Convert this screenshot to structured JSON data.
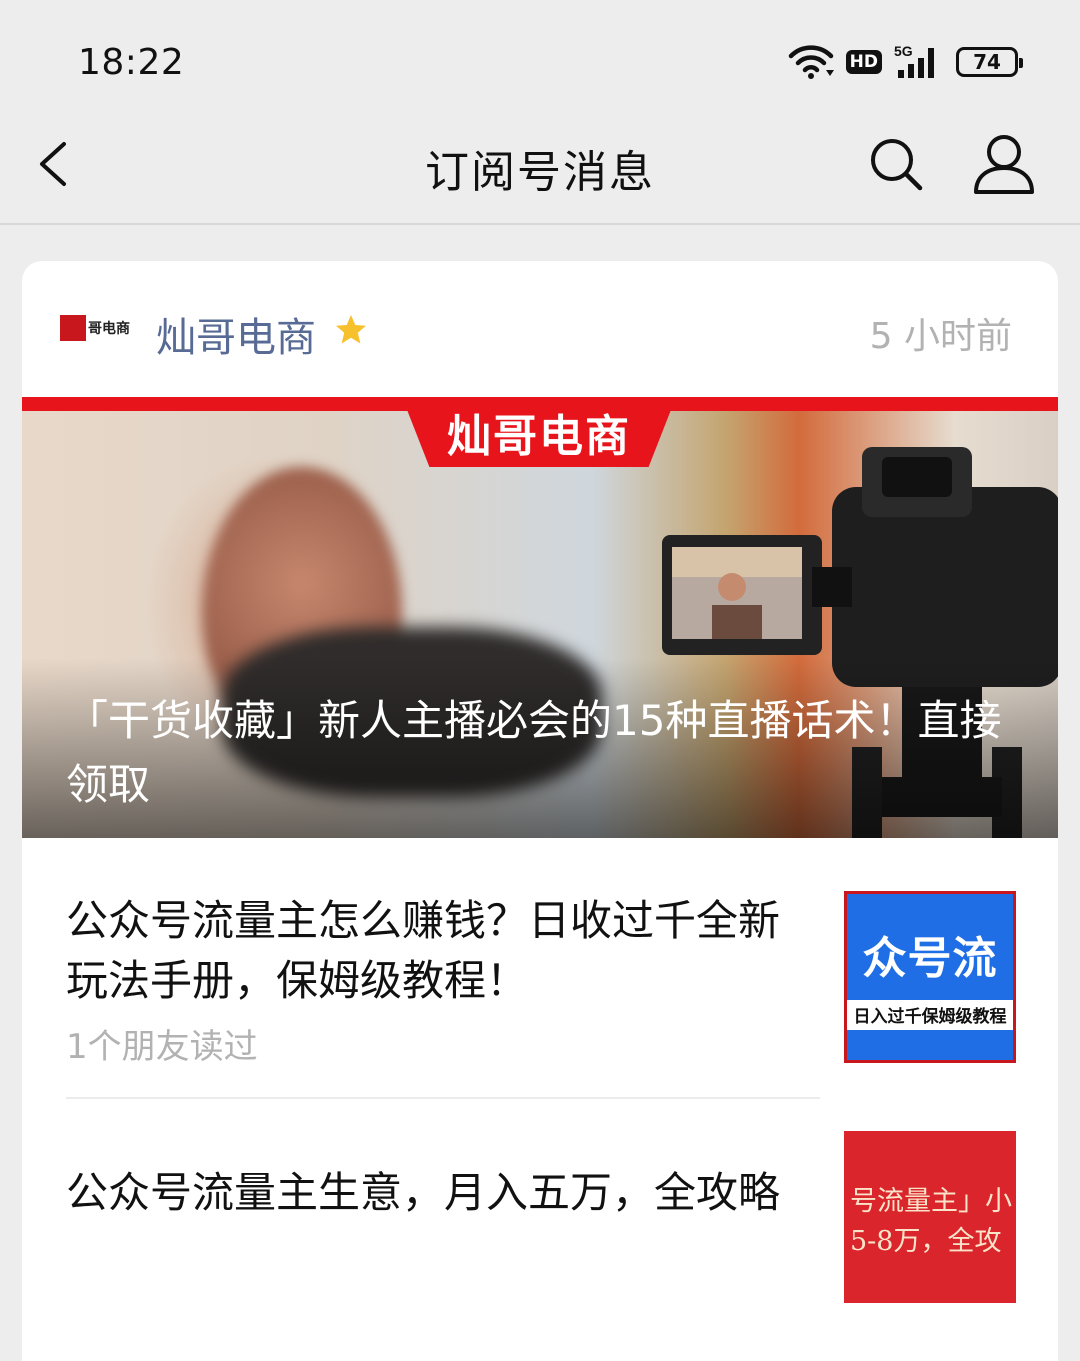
{
  "status_bar": {
    "time": "18:22",
    "hd_label": "HD",
    "network_label": "5G",
    "battery": "74"
  },
  "nav": {
    "title": "订阅号消息",
    "back_icon": "chevron-left-icon",
    "search_icon": "search-icon",
    "profile_icon": "person-icon"
  },
  "account": {
    "logo_text": "哥电商",
    "name": "灿哥电商",
    "star_icon": "star-icon",
    "star_color": "#f6c12c",
    "time": "5 小时前"
  },
  "hero": {
    "badge": "灿哥电商",
    "title": "「干货收藏」新人主播必会的15种直播话术！直接领取"
  },
  "articles": [
    {
      "title": "公众号流量主怎么赚钱？日收过千全新玩法手册，保姆级教程！",
      "subtitle": "1个朋友读过",
      "thumb_big": "众号流",
      "thumb_small": "日入过千保姆级教程"
    },
    {
      "title": "公众号流量主生意，月入五万，全攻略",
      "thumb_line1": "号流量主」小",
      "thumb_line2": "5-8万，全攻"
    }
  ],
  "colors": {
    "background": "#ededed",
    "account_name": "#586b95",
    "brand_red": "#e8141c"
  }
}
